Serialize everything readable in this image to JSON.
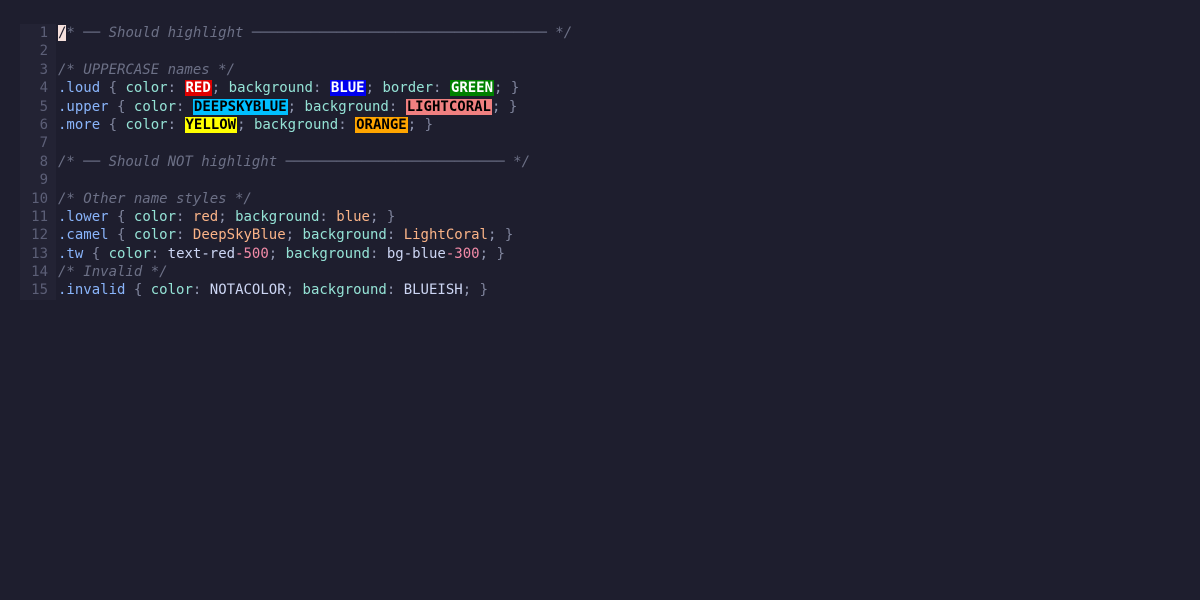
{
  "editor": {
    "line_numbers": [
      "1",
      "2",
      "3",
      "4",
      "5",
      "6",
      "7",
      "8",
      "9",
      "10",
      "11",
      "12",
      "13",
      "14",
      "15"
    ],
    "lines": {
      "l1": {
        "cursor_char": "/",
        "comment": "* ── Should highlight ─────────────────────────────────── */"
      },
      "l3": {
        "comment": "/* UPPERCASE names */"
      },
      "l4": {
        "selector": ".loud",
        "p1": "color",
        "v1": "RED",
        "p2": "background",
        "v2": "BLUE",
        "p3": "border",
        "v3": "GREEN"
      },
      "l5": {
        "selector": ".upper",
        "p1": "color",
        "v1": "DEEPSKYBLUE",
        "p2": "background",
        "v2": "LIGHTCORAL"
      },
      "l6": {
        "selector": ".more",
        "p1": "color",
        "v1": "YELLOW",
        "p2": "background",
        "v2": "ORANGE"
      },
      "l8": {
        "comment": "/* ── Should NOT highlight ────────────────────────── */"
      },
      "l10": {
        "comment": "/* Other name styles */"
      },
      "l11": {
        "selector": ".lower",
        "p1": "color",
        "v1": "red",
        "p2": "background",
        "v2": "blue"
      },
      "l12": {
        "selector": ".camel",
        "p1": "color",
        "v1": "DeepSkyBlue",
        "p2": "background",
        "v2": "LightCoral"
      },
      "l13": {
        "selector": ".tw",
        "p1": "color",
        "v1a": "text-red",
        "v1b": "-500",
        "p2": "background",
        "v2a": "bg-blue",
        "v2b": "-300"
      },
      "l14": {
        "comment": "/* Invalid */"
      },
      "l15": {
        "selector": ".invalid",
        "p1": "color",
        "v1": "NOTACOLOR",
        "p2": "background",
        "v2": "BLUEISH"
      }
    },
    "swatches": {
      "RED": {
        "bg": "#e00000",
        "fg": "#ffffff"
      },
      "BLUE": {
        "bg": "#0000ee",
        "fg": "#ffffff"
      },
      "GREEN": {
        "bg": "#008000",
        "fg": "#ffffff"
      },
      "DEEPSKYBLUE": {
        "bg": "#00bfff",
        "fg": "#000000"
      },
      "LIGHTCORAL": {
        "bg": "#f08080",
        "fg": "#000000"
      },
      "YELLOW": {
        "bg": "#ffff00",
        "fg": "#000000"
      },
      "ORANGE": {
        "bg": "#ffa500",
        "fg": "#000000"
      }
    }
  }
}
